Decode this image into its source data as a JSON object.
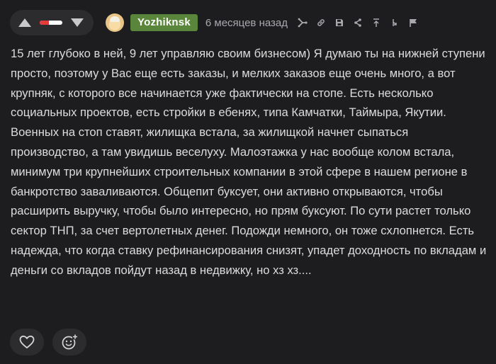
{
  "comment": {
    "author": "Yozhiknsk",
    "time_ago": "6 месяцев назад",
    "rating": {
      "negative_share": 0.4
    },
    "text": "15 лет глубоко в ней, 9 лет управляю своим бизнесом) Я думаю ты на нижней ступени просто, поэтому у Вас еще есть заказы, и мелких заказов еще очень много, а вот крупняк, с которого все начинается уже фактически на стопе. Есть несколько социальных проектов, есть стройки в ебенях, типа Камчатки, Таймыра, Якутии. Военных на стоп ставят, жилищка встала, за жилищкой начнет сыпаться производство, а там увидишь веселуху. Малоэтажка у нас вообще колом встала, минимум три крупнейших строительных компании в этой сфере в нашем регионе в банкротство заваливаются. Общепит буксует, они активно открываются, чтобы расширить выручку, чтобы было интересно, но прям буксуют. По сути растет только сектор ТНП, за счет вертолетных денег. Подожди немного, он тоже схлопнется. Есть надежда, что когда ставку рефинансирования снизят, упадет доходность по вкладам и деньги со вкладов пойдут назад в недвижку, но хз хз....",
    "tools": [
      "branch-icon",
      "link-icon",
      "save-icon",
      "share-icon",
      "scroll-top-icon",
      "parent-comment-icon",
      "report-flag-icon"
    ]
  },
  "colors": {
    "background": "#1d1d1f",
    "button_bg": "#2c2c2f",
    "username_bg": "#59863a",
    "negative": "#e23c3c",
    "text": "#dcdcdc",
    "muted": "#a9a9ad"
  }
}
